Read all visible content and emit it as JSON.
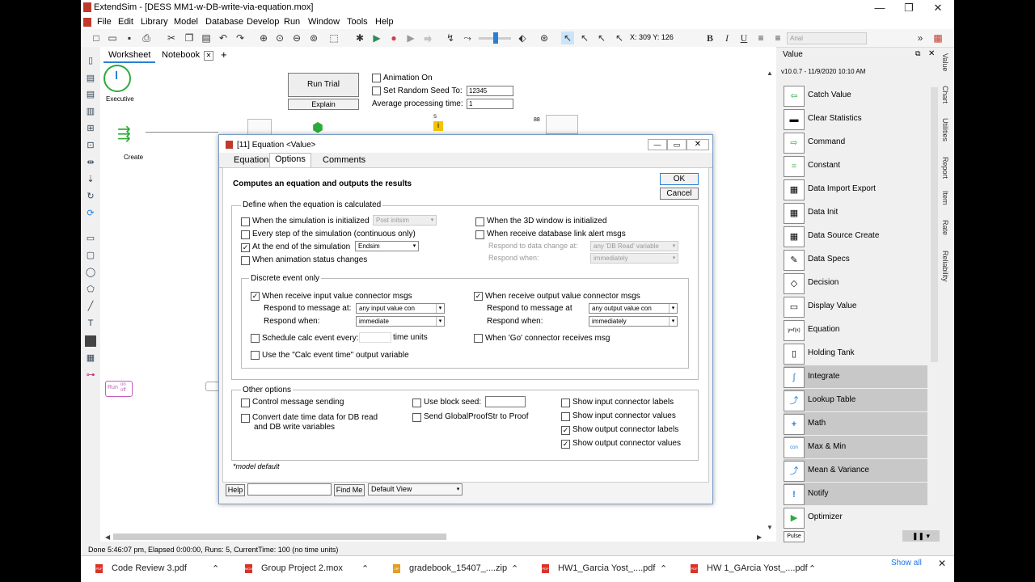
{
  "window": {
    "title": "ExtendSim - [DESS MM1-w-DB-write-via-equation.mox]",
    "controls": [
      "—",
      "❐",
      "✕"
    ]
  },
  "menu": [
    "File",
    "Edit",
    "Library",
    "Model",
    "Database",
    "Develop",
    "Run",
    "Window",
    "Tools",
    "Help"
  ],
  "toolbar": {
    "coords": "X: 309 Y: 126",
    "font_name": "Arial"
  },
  "tabs": {
    "worksheet": "Worksheet",
    "notebook": "Notebook",
    "add": "+"
  },
  "model": {
    "executive_label": "Executive",
    "create_label": "Create",
    "run_trial": "Run Trial",
    "explain": "Explain",
    "animation_on": "Animation On",
    "set_random_seed": "Set Random Seed To:",
    "seed_value": "12345",
    "avg_processing_time": "Average processing time:",
    "avg_value": "1",
    "run_toggle_label": "Run",
    "toggle_on": "on",
    "toggle_off": "off",
    "marker_s": "S",
    "marker_88": "88"
  },
  "dialog": {
    "title": "[11] Equation <Value>",
    "tabs": [
      "Equation",
      "Options",
      "Comments"
    ],
    "heading": "Computes an equation and outputs the results",
    "ok": "OK",
    "cancel": "Cancel",
    "define_group": "Define when the equation is calculated",
    "when_initialized": "When the simulation is initialized",
    "post_initsim": "Post initsim",
    "every_step": "Every step of the simulation (continuous only)",
    "at_end": "At the end of the simulation",
    "endsim": "Endsim",
    "anim_status": "When animation status changes",
    "when_3d": "When the 3D window is initialized",
    "when_db_alert": "When receive database link alert msgs",
    "respond_data_change": "Respond to data change at:",
    "any_db_read": "any 'DB Read' variable",
    "respond_when_grey": "Respond when:",
    "immediately_grey": "immediately",
    "discrete_group": "Discrete event only",
    "input_msgs": "When receive input value connector msgs",
    "respond_msg_at": "Respond to message at:",
    "any_input": "any input value con",
    "respond_when": "Respond when:",
    "immediate": "immediate",
    "output_msgs": "When receive output value connector msgs",
    "respond_msg_at_out": "Respond to message at",
    "any_output": "any output value con",
    "respond_when_out": "Respond when:",
    "immediately": "immediately",
    "schedule_calc": "Schedule calc event every:",
    "time_units": "time units",
    "go_connector": "When 'Go' connector receives msg",
    "use_calc_time": "Use the \"Calc event time\" output variable",
    "other_group": "Other options",
    "control_msg": "Control message sending",
    "convert_date": "Convert date time data for DB read",
    "convert_date2": "and DB write variables",
    "use_block_seed": "Use block seed:",
    "send_global": "Send GlobalProofStr to Proof",
    "show_input_labels": "Show input connector labels",
    "show_input_values": "Show input connector values",
    "show_output_labels": "Show output connector labels",
    "show_output_values": "Show output connector values",
    "model_default": "*model default",
    "help": "Help",
    "find_me": "Find Me",
    "default_view": "Default View"
  },
  "value_panel": {
    "title": "Value",
    "version": "v10.0.7 - 11/9/2020 10:10 AM",
    "items": [
      {
        "label": "Catch Value",
        "icon": "⇦"
      },
      {
        "label": "Clear Statistics",
        "icon": "▬"
      },
      {
        "label": "Command",
        "icon": "⇨"
      },
      {
        "label": "Constant",
        "icon": "="
      },
      {
        "label": "Data Import Export",
        "icon": "▦"
      },
      {
        "label": "Data Init",
        "icon": "▦"
      },
      {
        "label": "Data Source Create",
        "icon": "▦"
      },
      {
        "label": "Data Specs",
        "icon": "✎"
      },
      {
        "label": "Decision",
        "icon": "◇"
      },
      {
        "label": "Display Value",
        "icon": "▭"
      },
      {
        "label": "Equation",
        "icon": "y=f(x)"
      },
      {
        "label": "Holding Tank",
        "icon": "▯"
      },
      {
        "label": "Integrate",
        "icon": "∫"
      },
      {
        "label": "Lookup Table",
        "icon": "⤴"
      },
      {
        "label": "Math",
        "icon": "+"
      },
      {
        "label": "Max & Min",
        "icon": "con"
      },
      {
        "label": "Mean & Variance",
        "icon": "⤴"
      },
      {
        "label": "Notify",
        "icon": "!"
      },
      {
        "label": "Optimizer",
        "icon": "▶"
      },
      {
        "label": "",
        "icon": "Pulse"
      }
    ]
  },
  "side_tabs": [
    "Value",
    "Chart",
    "Utilities",
    "Report",
    "Item",
    "Rate",
    "Reliability"
  ],
  "status": "Done 5:46:07 pm, Elapsed 0:00:00, Runs: 5, CurrentTime: 100 (no time units)",
  "downloads": [
    {
      "name": "Code Review 3.pdf",
      "icon": "PDF"
    },
    {
      "name": "Group Project 2.mox",
      "icon": "MOX"
    },
    {
      "name": "gradebook_15407_....zip",
      "icon": "ZIP"
    },
    {
      "name": "HW1_Garcia Yost_....pdf",
      "icon": "PDF"
    },
    {
      "name": "HW 1_GArcia Yost_....pdf",
      "icon": "PDF"
    }
  ],
  "show_all": "Show all"
}
